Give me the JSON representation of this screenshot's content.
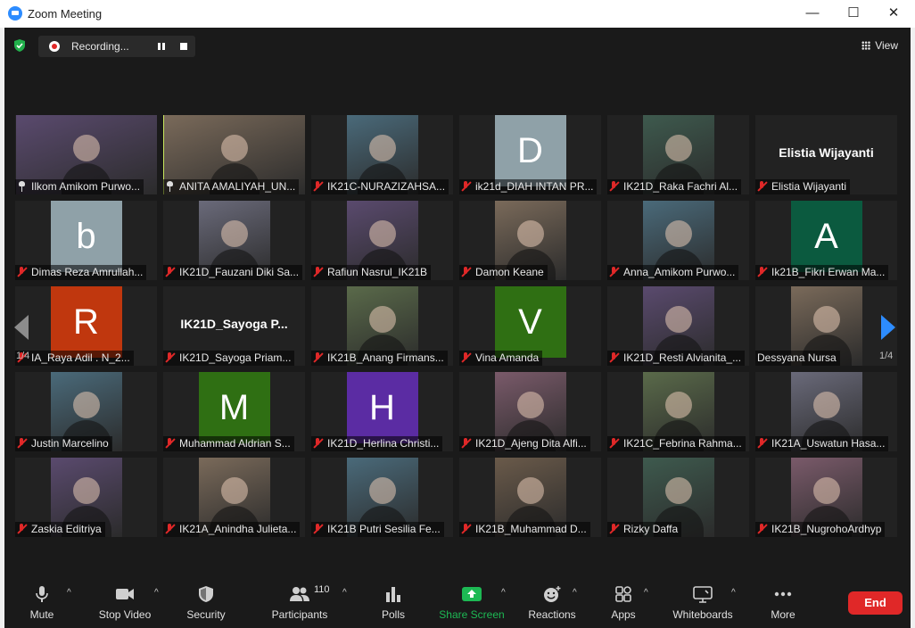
{
  "window": {
    "title": "Zoom Meeting",
    "minimize": "—",
    "maximize": "☐",
    "close": "✕"
  },
  "recording": {
    "label": "Recording..."
  },
  "view": {
    "label": "View"
  },
  "pagination": {
    "left": "1/4",
    "right": "1/4"
  },
  "colors": {
    "accent": "#2d8cff",
    "active_speaker": "#c7e65c",
    "muted": "#e02828",
    "end": "#e02828",
    "share": "#1db954"
  },
  "tiles": [
    {
      "name": "Ilkom Amikom Purwo...",
      "type": "video",
      "icon": "pin-icon"
    },
    {
      "name": "ANITA AMALIYAH_UN...",
      "type": "video",
      "icon": "pin-icon",
      "active": true
    },
    {
      "name": "IK21C-NURAZIZAHSA...",
      "type": "video",
      "icon": "mic-muted-icon"
    },
    {
      "name": "ik21d_DIAH INTAN PR...",
      "type": "letter",
      "letter": "D",
      "color": "#8fa1a8",
      "icon": "mic-muted-icon"
    },
    {
      "name": "IK21D_Raka Fachri Al...",
      "type": "video",
      "icon": "mic-muted-icon"
    },
    {
      "name": "Elistia Wijayanti",
      "type": "name",
      "big": "Elistia Wijayanti",
      "icon": "mic-muted-icon"
    },
    {
      "name": "Dimas Reza Amrullah...",
      "type": "letter",
      "letter": "b",
      "color": "#8fa1a8",
      "icon": "mic-muted-icon"
    },
    {
      "name": "IK21D_Fauzani Diki Sa...",
      "type": "video",
      "icon": "mic-muted-icon"
    },
    {
      "name": "Rafiun Nasrul_IK21B",
      "type": "video",
      "icon": "mic-muted-icon"
    },
    {
      "name": "Damon Keane",
      "type": "video",
      "icon": "mic-muted-icon"
    },
    {
      "name": "Anna_Amikom Purwo...",
      "type": "video",
      "icon": "mic-muted-icon"
    },
    {
      "name": "Ik21B_Fikri Erwan Ma...",
      "type": "letter",
      "letter": "A",
      "color": "#0b5a3f",
      "icon": "mic-muted-icon"
    },
    {
      "name": "IA_Raya Adil . N_2...",
      "type": "letter",
      "letter": "R",
      "color": "#c0370e",
      "icon": "mic-muted-icon"
    },
    {
      "name": "IK21D_Sayoga Priam...",
      "type": "name",
      "big": "IK21D_Sayoga  P...",
      "icon": "mic-muted-icon"
    },
    {
      "name": "IK21B_Anang Firmans...",
      "type": "video",
      "icon": "mic-muted-icon"
    },
    {
      "name": "Vina Amanda",
      "type": "letter",
      "letter": "V",
      "color": "#2f6f13",
      "icon": "mic-muted-icon"
    },
    {
      "name": "IK21D_Resti Alvianita_...",
      "type": "video",
      "icon": "mic-muted-icon"
    },
    {
      "name": "Dessyana Nursa",
      "type": "video",
      "icon": "none"
    },
    {
      "name": "Justin Marcelino",
      "type": "video",
      "icon": "mic-muted-icon"
    },
    {
      "name": "Muhammad Aldrian S...",
      "type": "letter",
      "letter": "M",
      "color": "#2f6f13",
      "icon": "mic-muted-icon"
    },
    {
      "name": "IK21D_Herlina Christi...",
      "type": "letter",
      "letter": "H",
      "color": "#5b2ca3",
      "icon": "mic-muted-icon"
    },
    {
      "name": "IK21D_Ajeng Dita Alfi...",
      "type": "video",
      "icon": "mic-muted-icon"
    },
    {
      "name": "IK21C_Febrina Rahma...",
      "type": "video",
      "icon": "mic-muted-icon"
    },
    {
      "name": "IK21A_Uswatun Hasa...",
      "type": "video",
      "icon": "mic-muted-icon"
    },
    {
      "name": "Zaskia Editriya",
      "type": "video",
      "icon": "mic-muted-icon"
    },
    {
      "name": "IK21A_Anindha Julieta...",
      "type": "video",
      "icon": "mic-muted-icon"
    },
    {
      "name": "IK21B Putri Sesilia Fe...",
      "type": "video",
      "icon": "mic-muted-icon"
    },
    {
      "name": "IK21B_Muhammad D...",
      "type": "video",
      "icon": "mic-muted-icon"
    },
    {
      "name": "Rizky Daffa",
      "type": "video",
      "icon": "mic-muted-icon"
    },
    {
      "name": "IK21B_NugrohoArdhyp",
      "type": "video",
      "icon": "mic-muted-icon"
    }
  ],
  "toolbar": {
    "mute": "Mute",
    "stop_video": "Stop Video",
    "security": "Security",
    "participants": "Participants",
    "participants_count": "110",
    "polls": "Polls",
    "share_screen": "Share Screen",
    "reactions": "Reactions",
    "apps": "Apps",
    "whiteboards": "Whiteboards",
    "more": "More",
    "end": "End"
  }
}
